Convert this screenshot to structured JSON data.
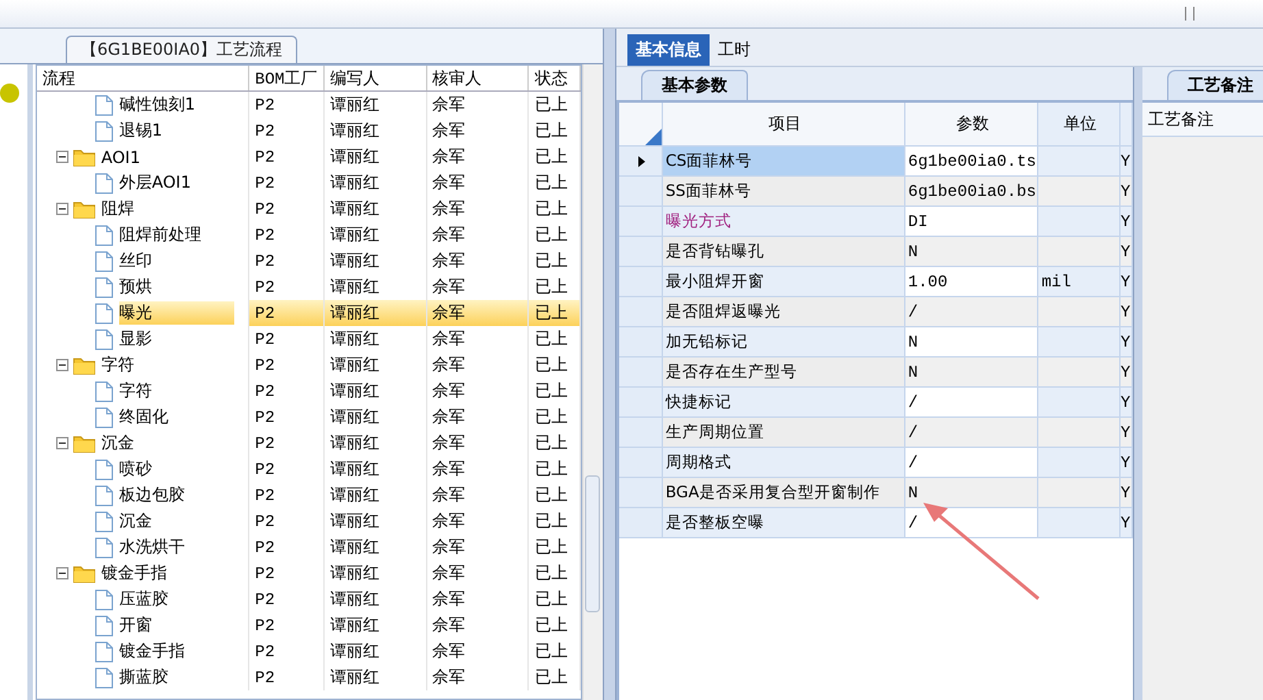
{
  "flow_panel": {
    "title": "【6G1BE00IA0】工艺流程",
    "columns": [
      "流程",
      "BOM工厂",
      "编写人",
      "核审人",
      "状态"
    ],
    "tree": [
      {
        "kind": "continued",
        "children": [
          {
            "label": "碱性蚀刻1",
            "kind": "step",
            "bom": "P2",
            "author": "谭丽红",
            "reviewer": "佘军",
            "status": "已上",
            "selected": false
          },
          {
            "label": "退锡1",
            "kind": "step",
            "bom": "P2",
            "author": "谭丽红",
            "reviewer": "佘军",
            "status": "已上",
            "selected": false
          }
        ]
      },
      {
        "label": "AOI1",
        "kind": "group",
        "expanded": true,
        "bom": "P2",
        "author": "谭丽红",
        "reviewer": "佘军",
        "status": "已上",
        "selected": false,
        "children": [
          {
            "label": "外层AOI1",
            "kind": "step",
            "bom": "P2",
            "author": "谭丽红",
            "reviewer": "佘军",
            "status": "已上",
            "selected": false
          }
        ]
      },
      {
        "label": "阻焊",
        "kind": "group",
        "expanded": true,
        "bom": "P2",
        "author": "谭丽红",
        "reviewer": "佘军",
        "status": "已上",
        "selected": false,
        "children": [
          {
            "label": "阻焊前处理",
            "kind": "step",
            "bom": "P2",
            "author": "谭丽红",
            "reviewer": "佘军",
            "status": "已上",
            "selected": false
          },
          {
            "label": "丝印",
            "kind": "step",
            "bom": "P2",
            "author": "谭丽红",
            "reviewer": "佘军",
            "status": "已上",
            "selected": false
          },
          {
            "label": "预烘",
            "kind": "step",
            "bom": "P2",
            "author": "谭丽红",
            "reviewer": "佘军",
            "status": "已上",
            "selected": false
          },
          {
            "label": "曝光",
            "kind": "step",
            "bom": "P2",
            "author": "谭丽红",
            "reviewer": "佘军",
            "status": "已上",
            "selected": true
          },
          {
            "label": "显影",
            "kind": "step",
            "bom": "P2",
            "author": "谭丽红",
            "reviewer": "佘军",
            "status": "已上",
            "selected": false
          }
        ]
      },
      {
        "label": "字符",
        "kind": "group",
        "expanded": true,
        "bom": "P2",
        "author": "谭丽红",
        "reviewer": "佘军",
        "status": "已上",
        "selected": false,
        "children": [
          {
            "label": "字符",
            "kind": "step",
            "bom": "P2",
            "author": "谭丽红",
            "reviewer": "佘军",
            "status": "已上",
            "selected": false
          },
          {
            "label": "终固化",
            "kind": "step",
            "bom": "P2",
            "author": "谭丽红",
            "reviewer": "佘军",
            "status": "已上",
            "selected": false
          }
        ]
      },
      {
        "label": "沉金",
        "kind": "group",
        "expanded": true,
        "bom": "P2",
        "author": "谭丽红",
        "reviewer": "佘军",
        "status": "已上",
        "selected": false,
        "children": [
          {
            "label": "喷砂",
            "kind": "step",
            "bom": "P2",
            "author": "谭丽红",
            "reviewer": "佘军",
            "status": "已上",
            "selected": false
          },
          {
            "label": "板边包胶",
            "kind": "step",
            "bom": "P2",
            "author": "谭丽红",
            "reviewer": "佘军",
            "status": "已上",
            "selected": false
          },
          {
            "label": "沉金",
            "kind": "step",
            "bom": "P2",
            "author": "谭丽红",
            "reviewer": "佘军",
            "status": "已上",
            "selected": false
          },
          {
            "label": "水洗烘干",
            "kind": "step",
            "bom": "P2",
            "author": "谭丽红",
            "reviewer": "佘军",
            "status": "已上",
            "selected": false
          }
        ]
      },
      {
        "label": "镀金手指",
        "kind": "group",
        "expanded": true,
        "bom": "P2",
        "author": "谭丽红",
        "reviewer": "佘军",
        "status": "已上",
        "selected": false,
        "children": [
          {
            "label": "压蓝胶",
            "kind": "step",
            "bom": "P2",
            "author": "谭丽红",
            "reviewer": "佘军",
            "status": "已上",
            "selected": false
          },
          {
            "label": "开窗",
            "kind": "step",
            "bom": "P2",
            "author": "谭丽红",
            "reviewer": "佘军",
            "status": "已上",
            "selected": false
          },
          {
            "label": "镀金手指",
            "kind": "step",
            "bom": "P2",
            "author": "谭丽红",
            "reviewer": "佘军",
            "status": "已上",
            "selected": false
          },
          {
            "label": "撕蓝胶",
            "kind": "step",
            "bom": "P2",
            "author": "谭丽红",
            "reviewer": "佘军",
            "status": "已上",
            "selected": false
          }
        ]
      }
    ]
  },
  "tabs": [
    {
      "label": "基本信息",
      "selected": true
    },
    {
      "label": "工时",
      "selected": false
    }
  ],
  "params_panel": {
    "title": "基本参数",
    "columns": [
      "项目",
      "参数",
      "单位"
    ],
    "rows": [
      {
        "item": "CS面菲林号",
        "value": "6g1be00ia0.ts",
        "unit": "",
        "column_4": "Y",
        "selected": true
      },
      {
        "item": "SS面菲林号",
        "value": "6g1be00ia0.bs",
        "unit": "",
        "column_4": "Y",
        "selected": false
      },
      {
        "item": "曝光方式",
        "value": "DI",
        "unit": "",
        "column_4": "Y",
        "selected": false,
        "color": "#a0207f"
      },
      {
        "item": "是否背钻曝孔",
        "value": "N",
        "unit": "",
        "column_4": "Y",
        "selected": false
      },
      {
        "item": "最小阻焊开窗",
        "value": "1.00",
        "unit": "mil",
        "column_4": "Y",
        "selected": false
      },
      {
        "item": "是否阻焊返曝光",
        "value": "/",
        "unit": "",
        "column_4": "Y",
        "selected": false
      },
      {
        "item": "加无铅标记",
        "value": "N",
        "unit": "",
        "column_4": "Y",
        "selected": false
      },
      {
        "item": "是否存在生产型号",
        "value": "N",
        "unit": "",
        "column_4": "Y",
        "selected": false
      },
      {
        "item": "快捷标记",
        "value": "/",
        "unit": "",
        "column_4": "Y",
        "selected": false
      },
      {
        "item": "生产周期位置",
        "value": "/",
        "unit": "",
        "column_4": "Y",
        "selected": false
      },
      {
        "item": "周期格式",
        "value": "/",
        "unit": "",
        "column_4": "Y",
        "selected": false
      },
      {
        "item": "BGA是否采用复合型开窗制作",
        "value": "N",
        "unit": "",
        "column_4": "Y",
        "selected": false
      },
      {
        "item": "是否整板空曝",
        "value": "/",
        "unit": "",
        "column_4": "Y",
        "selected": false
      }
    ]
  },
  "notes_panel": {
    "title": "工艺备注",
    "label": "工艺备注"
  }
}
